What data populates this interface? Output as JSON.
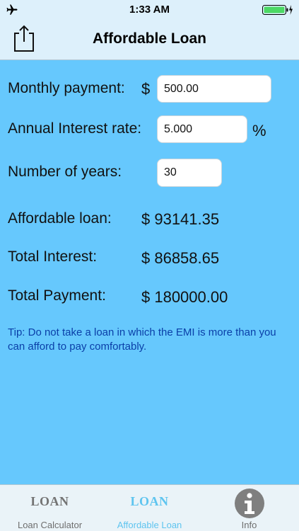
{
  "status_bar": {
    "time": "1:33 AM"
  },
  "nav_bar": {
    "title": "Affordable Loan"
  },
  "form": {
    "monthly_payment": {
      "label": "Monthly payment:",
      "currency": "$",
      "value": "500.00"
    },
    "interest_rate": {
      "label": "Annual Interest rate:",
      "value": "5.000",
      "unit": "%"
    },
    "years": {
      "label": "Number of years:",
      "value": "30"
    }
  },
  "results": {
    "affordable_loan": {
      "label": "Affordable loan:",
      "value": "$  93141.35"
    },
    "total_interest": {
      "label": "Total Interest:",
      "value": "$  86858.65"
    },
    "total_payment": {
      "label": "Total Payment:",
      "value": "$  180000.00"
    }
  },
  "tip": "Tip: Do not take a loan in which the EMI is more than you can afford to pay comfortably.",
  "tabs": [
    {
      "logo": "LOAN",
      "label": "Loan Calculator",
      "active": false
    },
    {
      "logo": "LOAN",
      "label": "Affordable Loan",
      "active": true
    },
    {
      "icon": "info-icon",
      "label": "Info",
      "active": false
    }
  ],
  "colors": {
    "background": "#66c8fd",
    "bar": "#ddf0fb",
    "tip_text": "#0a3fa8",
    "tab_active": "#5ec4ef",
    "battery_green": "#4cd964"
  }
}
